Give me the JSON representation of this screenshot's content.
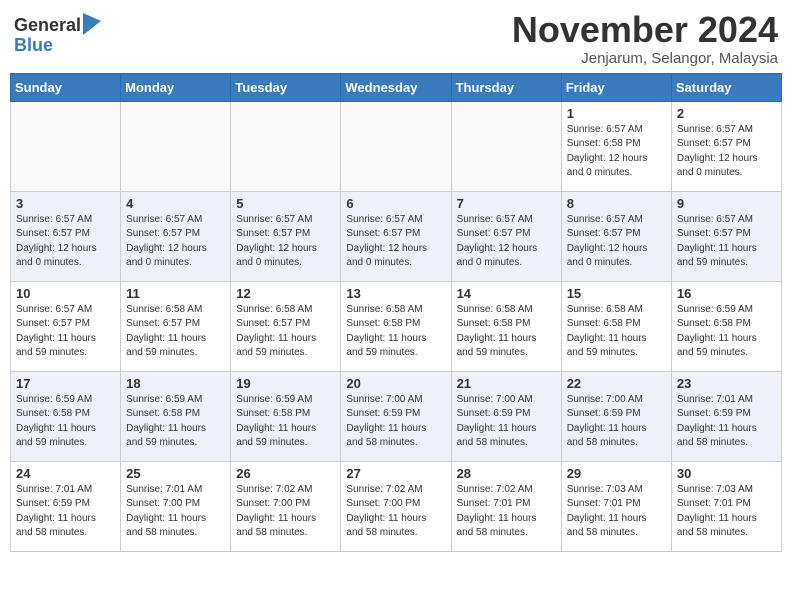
{
  "header": {
    "logo_general": "General",
    "logo_blue": "Blue",
    "month_title": "November 2024",
    "location": "Jenjarum, Selangor, Malaysia"
  },
  "days_of_week": [
    "Sunday",
    "Monday",
    "Tuesday",
    "Wednesday",
    "Thursday",
    "Friday",
    "Saturday"
  ],
  "weeks": [
    [
      {
        "day": "",
        "info": ""
      },
      {
        "day": "",
        "info": ""
      },
      {
        "day": "",
        "info": ""
      },
      {
        "day": "",
        "info": ""
      },
      {
        "day": "",
        "info": ""
      },
      {
        "day": "1",
        "info": "Sunrise: 6:57 AM\nSunset: 6:58 PM\nDaylight: 12 hours and 0 minutes."
      },
      {
        "day": "2",
        "info": "Sunrise: 6:57 AM\nSunset: 6:57 PM\nDaylight: 12 hours and 0 minutes."
      }
    ],
    [
      {
        "day": "3",
        "info": "Sunrise: 6:57 AM\nSunset: 6:57 PM\nDaylight: 12 hours and 0 minutes."
      },
      {
        "day": "4",
        "info": "Sunrise: 6:57 AM\nSunset: 6:57 PM\nDaylight: 12 hours and 0 minutes."
      },
      {
        "day": "5",
        "info": "Sunrise: 6:57 AM\nSunset: 6:57 PM\nDaylight: 12 hours and 0 minutes."
      },
      {
        "day": "6",
        "info": "Sunrise: 6:57 AM\nSunset: 6:57 PM\nDaylight: 12 hours and 0 minutes."
      },
      {
        "day": "7",
        "info": "Sunrise: 6:57 AM\nSunset: 6:57 PM\nDaylight: 12 hours and 0 minutes."
      },
      {
        "day": "8",
        "info": "Sunrise: 6:57 AM\nSunset: 6:57 PM\nDaylight: 12 hours and 0 minutes."
      },
      {
        "day": "9",
        "info": "Sunrise: 6:57 AM\nSunset: 6:57 PM\nDaylight: 11 hours and 59 minutes."
      }
    ],
    [
      {
        "day": "10",
        "info": "Sunrise: 6:57 AM\nSunset: 6:57 PM\nDaylight: 11 hours and 59 minutes."
      },
      {
        "day": "11",
        "info": "Sunrise: 6:58 AM\nSunset: 6:57 PM\nDaylight: 11 hours and 59 minutes."
      },
      {
        "day": "12",
        "info": "Sunrise: 6:58 AM\nSunset: 6:57 PM\nDaylight: 11 hours and 59 minutes."
      },
      {
        "day": "13",
        "info": "Sunrise: 6:58 AM\nSunset: 6:58 PM\nDaylight: 11 hours and 59 minutes."
      },
      {
        "day": "14",
        "info": "Sunrise: 6:58 AM\nSunset: 6:58 PM\nDaylight: 11 hours and 59 minutes."
      },
      {
        "day": "15",
        "info": "Sunrise: 6:58 AM\nSunset: 6:58 PM\nDaylight: 11 hours and 59 minutes."
      },
      {
        "day": "16",
        "info": "Sunrise: 6:59 AM\nSunset: 6:58 PM\nDaylight: 11 hours and 59 minutes."
      }
    ],
    [
      {
        "day": "17",
        "info": "Sunrise: 6:59 AM\nSunset: 6:58 PM\nDaylight: 11 hours and 59 minutes."
      },
      {
        "day": "18",
        "info": "Sunrise: 6:59 AM\nSunset: 6:58 PM\nDaylight: 11 hours and 59 minutes."
      },
      {
        "day": "19",
        "info": "Sunrise: 6:59 AM\nSunset: 6:58 PM\nDaylight: 11 hours and 59 minutes."
      },
      {
        "day": "20",
        "info": "Sunrise: 7:00 AM\nSunset: 6:59 PM\nDaylight: 11 hours and 58 minutes."
      },
      {
        "day": "21",
        "info": "Sunrise: 7:00 AM\nSunset: 6:59 PM\nDaylight: 11 hours and 58 minutes."
      },
      {
        "day": "22",
        "info": "Sunrise: 7:00 AM\nSunset: 6:59 PM\nDaylight: 11 hours and 58 minutes."
      },
      {
        "day": "23",
        "info": "Sunrise: 7:01 AM\nSunset: 6:59 PM\nDaylight: 11 hours and 58 minutes."
      }
    ],
    [
      {
        "day": "24",
        "info": "Sunrise: 7:01 AM\nSunset: 6:59 PM\nDaylight: 11 hours and 58 minutes."
      },
      {
        "day": "25",
        "info": "Sunrise: 7:01 AM\nSunset: 7:00 PM\nDaylight: 11 hours and 58 minutes."
      },
      {
        "day": "26",
        "info": "Sunrise: 7:02 AM\nSunset: 7:00 PM\nDaylight: 11 hours and 58 minutes."
      },
      {
        "day": "27",
        "info": "Sunrise: 7:02 AM\nSunset: 7:00 PM\nDaylight: 11 hours and 58 minutes."
      },
      {
        "day": "28",
        "info": "Sunrise: 7:02 AM\nSunset: 7:01 PM\nDaylight: 11 hours and 58 minutes."
      },
      {
        "day": "29",
        "info": "Sunrise: 7:03 AM\nSunset: 7:01 PM\nDaylight: 11 hours and 58 minutes."
      },
      {
        "day": "30",
        "info": "Sunrise: 7:03 AM\nSunset: 7:01 PM\nDaylight: 11 hours and 58 minutes."
      }
    ]
  ]
}
